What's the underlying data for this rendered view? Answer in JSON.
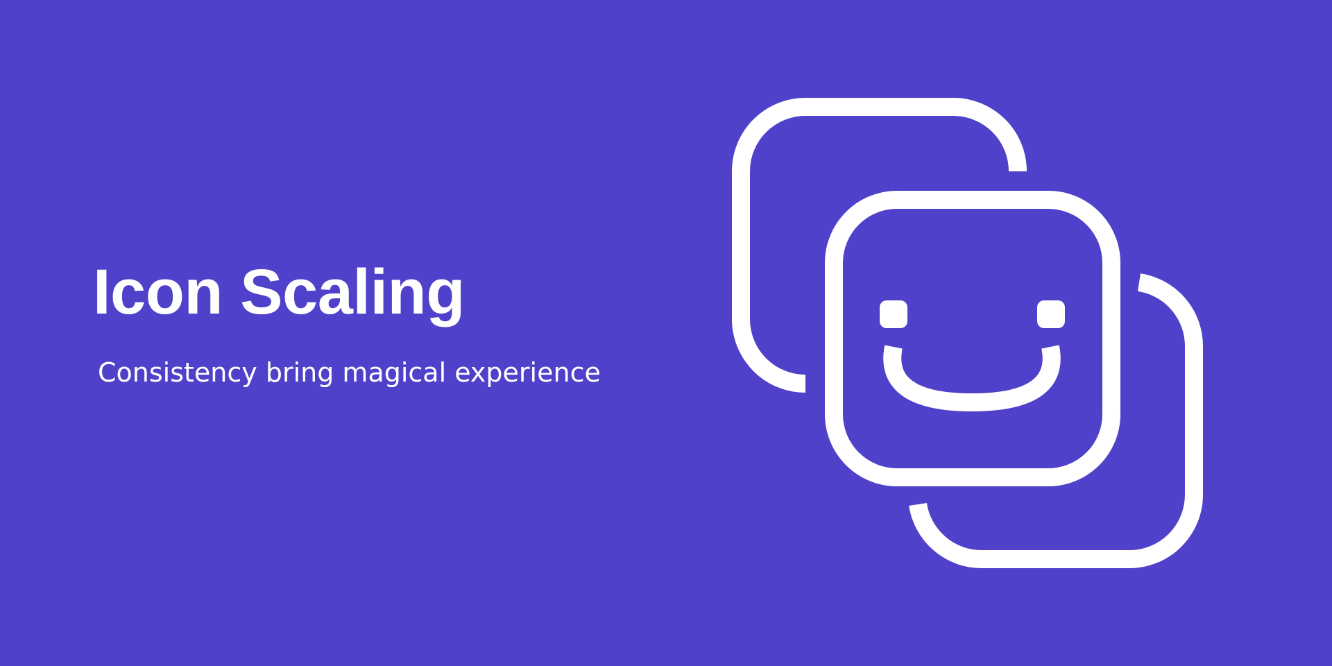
{
  "hero": {
    "title": "Icon Scaling",
    "subtitle": "Consistency bring magical experience"
  },
  "illustration": {
    "icon": "stacked-squares-smile-icon"
  },
  "colors": {
    "background": "#4f41c9",
    "foreground": "#ffffff"
  }
}
